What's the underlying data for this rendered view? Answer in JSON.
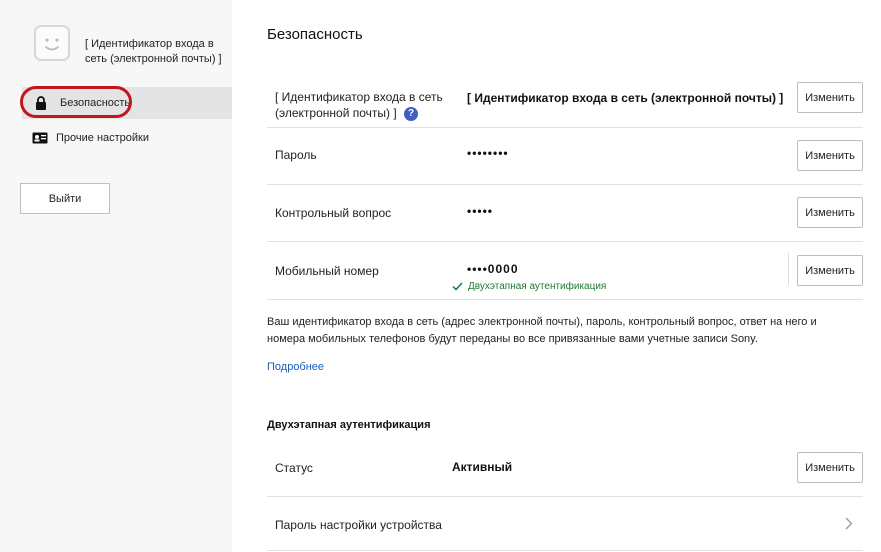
{
  "sidebar": {
    "user_id": "[ Идентификатор входа в сеть (электронной почты) ]",
    "items": [
      {
        "label": "Безопасность",
        "icon": "lock-icon"
      },
      {
        "label": "Прочие настройки",
        "icon": "id-card-icon"
      }
    ],
    "logout_label": "Выйти"
  },
  "main": {
    "title": "Безопасность",
    "rows": [
      {
        "label": "[ Идентификатор входа в сеть (электронной почты) ]",
        "value": "[ Идентификатор входа в сеть (электронной почты) ]",
        "button": "Изменить"
      },
      {
        "label": "Пароль",
        "value": "••••••••",
        "button": "Изменить"
      },
      {
        "label": "Контрольный вопрос",
        "value": "•••••",
        "button": "Изменить"
      },
      {
        "label": "Мобильный номер",
        "value": "••••0000",
        "note": "Двухэтапная аутентификация",
        "button": "Изменить"
      }
    ],
    "info": "Ваш идентификатор входа в сеть (адрес электронной почты), пароль, контрольный вопрос, ответ на него и номера мобильных телефонов будут переданы во все привязанные вами учетные записи Sony.",
    "more_link": "Подробнее",
    "twofa": {
      "title": "Двухэтапная аутентификация",
      "status_label": "Статус",
      "status_value": "Активный",
      "status_button": "Изменить",
      "device_password_label": "Пароль настройки устройства"
    }
  },
  "colors": {
    "highlight": "#c0171d",
    "link": "#1b5fb8",
    "success": "#1f7a36",
    "help": "#3f5fbf"
  }
}
